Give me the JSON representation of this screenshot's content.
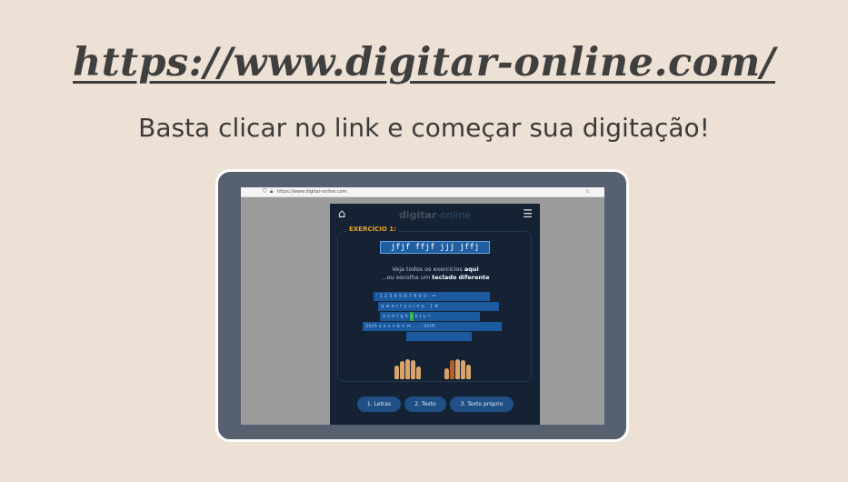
{
  "headline": "https://www.digitar-online.com/",
  "subtitle": "Basta clicar no link e começar sua digitação!",
  "browser": {
    "url": "https://www.digitar-online.com"
  },
  "app": {
    "logo_main": "digitar",
    "logo_accent": "-online",
    "exercise_title": "EXERCÍCIO 1:",
    "exercise_text": "jfjf ffjf jjj jffj",
    "see_all_prefix": "Veja todos os exercícios",
    "see_all_link": "aqui",
    "choose_prefix": "...ou escolha um",
    "choose_link": "teclado diferente",
    "keyboard_rows": [
      "'  1  2  3  4  5  6  7  8  9  0  -  =",
      "q  w  e  r  t  y  u  i  o  p  ´  [  ⊕",
      "a  s  d  f  g  h",
      "Shift  z  x  c  v  b  n  m  ,  .  ;  Shift"
    ],
    "home_key_highlight": "j",
    "keyboard_row3_tail": "k  l  ç  ~",
    "buttons": [
      "1. Letras",
      "2. Texto",
      "3. Texto próprio"
    ]
  },
  "colors": {
    "accent": "#e6a42c",
    "highlight_key": "#2aa84a",
    "app_bg": "#142233"
  }
}
